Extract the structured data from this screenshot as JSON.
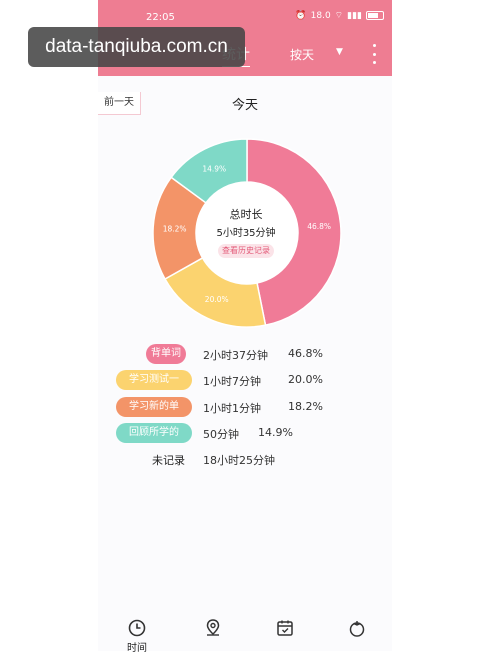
{
  "status_bar": {
    "time": "22:05",
    "signal_text": "18.0",
    "battery_text": ""
  },
  "header": {
    "tab_title": "统计",
    "period_label": "按天"
  },
  "watermark": "data-tanqiuba.com.cn",
  "date_nav": {
    "prev_label": "前一天",
    "title": "今天"
  },
  "chart_center": {
    "title": "总时长",
    "value": "5小时35分钟",
    "history_button": "查看历史记录"
  },
  "chart_data": {
    "type": "pie",
    "slices": [
      {
        "label": "背单词",
        "value": 46.8,
        "display": "46.8%",
        "color": "#f07b97"
      },
      {
        "label": "学习测试一",
        "value": 20.0,
        "display": "20.0%",
        "color": "#fbd36f"
      },
      {
        "label": "学习新的单",
        "value": 18.2,
        "display": "18.2%",
        "color": "#f39468"
      },
      {
        "label": "回顾所学的",
        "value": 14.9,
        "display": "14.9%",
        "color": "#7fd9c7"
      }
    ]
  },
  "legend": [
    {
      "name": "背单词",
      "duration": "2小时37分钟",
      "percent": "46.8%",
      "color": "#f07b97"
    },
    {
      "name": "学习测试一",
      "duration": "1小时7分钟",
      "percent": "20.0%",
      "color": "#fbd36f"
    },
    {
      "name": "学习新的单",
      "duration": "1小时1分钟",
      "percent": "18.2%",
      "color": "#f39468"
    },
    {
      "name": "回顾所学的",
      "duration": "50分钟",
      "percent": "14.9%",
      "color": "#7fd9c7"
    }
  ],
  "unrecorded": {
    "label": "未记录",
    "duration": "18小时25分钟"
  },
  "bottom_nav": [
    {
      "label": "时间",
      "icon": "clock-icon"
    },
    {
      "label": "",
      "icon": "location-pin-icon"
    },
    {
      "label": "",
      "icon": "calendar-check-icon"
    },
    {
      "label": "",
      "icon": "tomato-icon"
    }
  ]
}
